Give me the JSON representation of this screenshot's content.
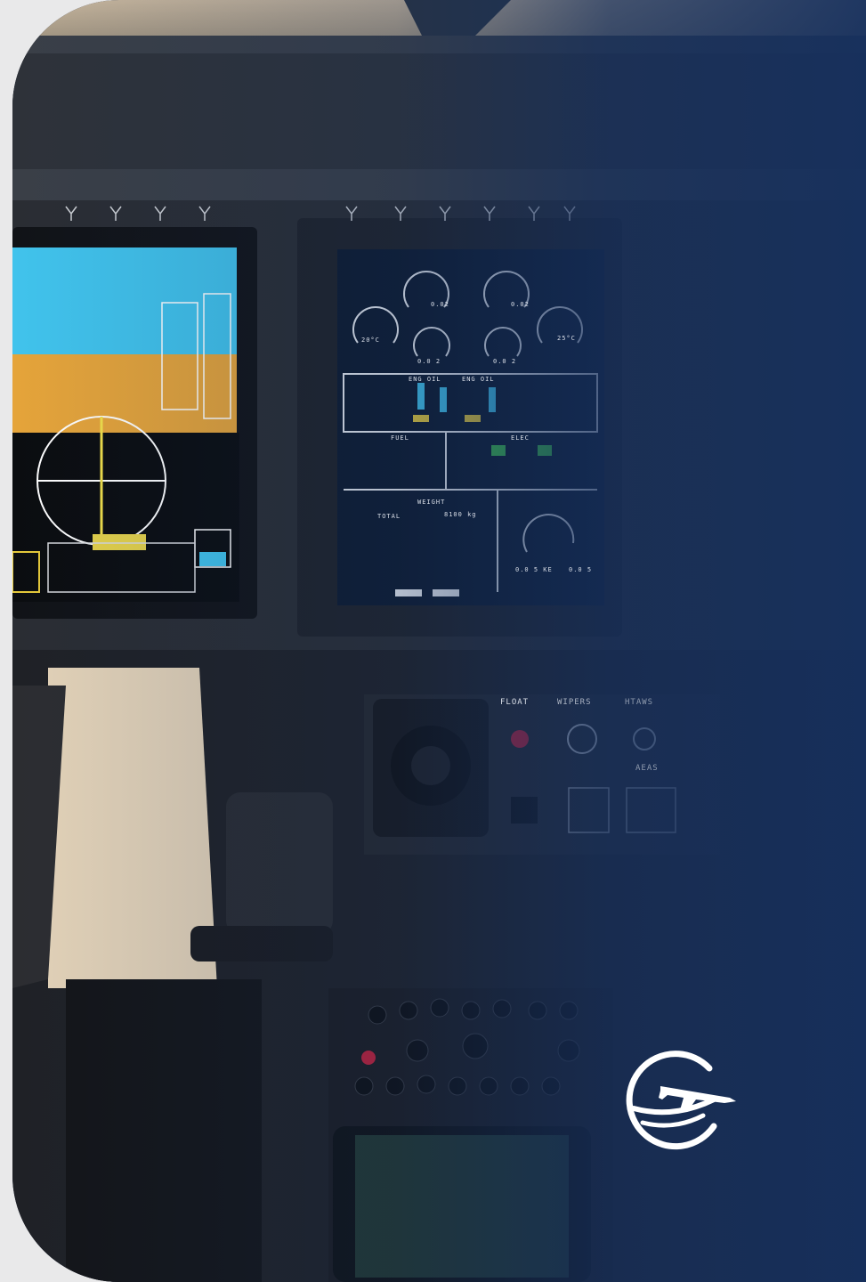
{
  "photo": {
    "subject": "helicopter cockpit instrument panel",
    "mfd_labels": {
      "temp_left": "20°C",
      "temp_right": "25°C",
      "torque_left": "0.02",
      "torque_right": "0.02",
      "n_left": "0.0 2",
      "n_right": "0.0 2",
      "eng_oil_1": "ENG OIL",
      "eng_oil_2": "ENG OIL",
      "fuel": "FUEL",
      "elec": "ELEC",
      "weight": "WEIGHT",
      "total": "TOTAL",
      "weight_value": "8100 kg",
      "bottom_left": "0.0 5 KE",
      "bottom_right": "0.0 5"
    },
    "panel_labels": {
      "float": "FLOAT",
      "wipers": "WIPERS",
      "htaws": "HTAWS",
      "aeas": "AEAS"
    },
    "overlay_color": "#16305e",
    "logo": "airplane-globe-logo"
  }
}
